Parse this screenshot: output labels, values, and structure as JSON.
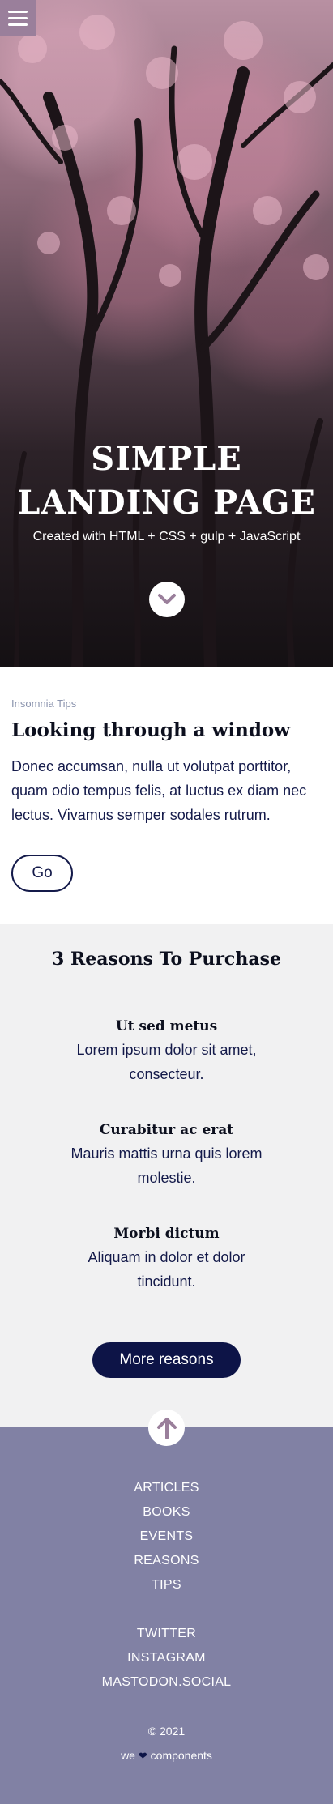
{
  "hero": {
    "title_line1": "SIMPLE",
    "title_line2": "LANDING PAGE",
    "subtitle": "Created with HTML + CSS + gulp + JavaScript",
    "menu_icon": "hamburger-icon",
    "scroll_icon": "chevron-down-icon"
  },
  "article": {
    "eyebrow": "Insomnia Tips",
    "title": "Looking through a window",
    "body": "Donec accumsan, nulla ut volutpat porttitor, quam odio tempus felis, at luctus ex diam nec lectus. Vivamus semper sodales rutrum.",
    "button": "Go"
  },
  "reasons": {
    "title": "3 Reasons To Purchase",
    "items": [
      {
        "title": "Ut sed metus",
        "text": "Lorem ipsum dolor sit amet, consecteur."
      },
      {
        "title": "Curabitur ac erat",
        "text": "Mauris mattis urna quis lorem molestie."
      },
      {
        "title": "Morbi dictum",
        "text": "Aliquam in dolor et dolor tincidunt."
      }
    ],
    "button": "More reasons"
  },
  "footer": {
    "up_icon": "arrow-up-icon",
    "nav": [
      "ARTICLES",
      "BOOKS",
      "EVENTS",
      "REASONS",
      "TIPS"
    ],
    "social": [
      "TWITTER",
      "INSTAGRAM",
      "MASTODON.SOCIAL"
    ],
    "copyright": "© 2021",
    "credit_prefix": "we",
    "credit_heart": "❤",
    "credit_suffix": "components"
  },
  "colors": {
    "navy": "#0d1447",
    "footer_bg": "#8181a4",
    "menu_bg": "#9a7f9b",
    "section_gray": "#f1f1f2",
    "up_arrow": "#9a7f9b"
  }
}
